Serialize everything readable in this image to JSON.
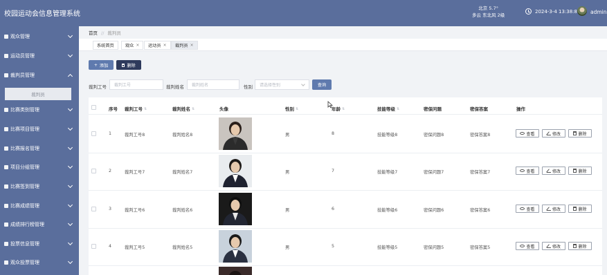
{
  "header": {
    "app_title": "校园运动会信息管理系统",
    "weather_city": "北京",
    "weather_temp": "5.7°",
    "weather_desc": "多云  东北风  2级",
    "datetime": "2024-3-4 13:38:8",
    "username": "admin"
  },
  "sidebar": {
    "items": [
      {
        "label": "观众管理",
        "expanded": false
      },
      {
        "label": "运动员管理",
        "expanded": false
      },
      {
        "label": "裁判员管理",
        "expanded": true
      },
      {
        "label": "比赛类别管理",
        "expanded": false
      },
      {
        "label": "比赛项目管理",
        "expanded": false
      },
      {
        "label": "比赛报名管理",
        "expanded": false
      },
      {
        "label": "项目分组管理",
        "expanded": false
      },
      {
        "label": "比赛签到管理",
        "expanded": false
      },
      {
        "label": "比赛成绩管理",
        "expanded": false
      },
      {
        "label": "成绩排行榜管理",
        "expanded": false
      },
      {
        "label": "投票信息管理",
        "expanded": false
      },
      {
        "label": "观众投票管理",
        "expanded": false
      }
    ],
    "active_sub": "裁判员"
  },
  "breadcrumb": {
    "home": "首页",
    "separator": "//",
    "current": "裁判员"
  },
  "tabs": [
    {
      "label": "系统首页",
      "closable": false
    },
    {
      "label": "观众",
      "closable": true
    },
    {
      "label": "运动员",
      "closable": true
    },
    {
      "label": "裁判员",
      "closable": true,
      "active": true
    }
  ],
  "tab_close_glyph": "×",
  "actions": {
    "add_label": "添加",
    "add_icon": "+",
    "delete_label": "删除"
  },
  "search": {
    "id_label": "裁判工号",
    "id_placeholder": "裁判工号",
    "name_label": "裁判姓名",
    "name_placeholder": "裁判姓名",
    "gender_label": "性别",
    "gender_placeholder": "请选择性别",
    "query_label": "查询"
  },
  "table": {
    "columns": [
      "序号",
      "裁判工号",
      "裁判姓名",
      "头像",
      "性别",
      "年龄",
      "技能等级",
      "密保问题",
      "密保答案",
      "操作"
    ],
    "rows": [
      {
        "index": "1",
        "judge_id": "裁判工号8",
        "judge_name": "裁判姓名8",
        "gender": "男",
        "age": "8",
        "skill": "技能等级8",
        "question": "密保问题8",
        "answer": "密保答案8"
      },
      {
        "index": "2",
        "judge_id": "裁判工号7",
        "judge_name": "裁判姓名7",
        "gender": "男",
        "age": "7",
        "skill": "技能等级7",
        "question": "密保问题7",
        "answer": "密保答案7"
      },
      {
        "index": "3",
        "judge_id": "裁判工号6",
        "judge_name": "裁判姓名6",
        "gender": "男",
        "age": "6",
        "skill": "技能等级6",
        "question": "密保问题6",
        "answer": "密保答案6"
      },
      {
        "index": "4",
        "judge_id": "裁判工号5",
        "judge_name": "裁判姓名5",
        "gender": "男",
        "age": "5",
        "skill": "技能等级5",
        "question": "密保问题5",
        "answer": "密保答案5"
      }
    ],
    "row_actions": {
      "view": "查看",
      "edit": "修改",
      "delete": "删除"
    }
  },
  "colors": {
    "sidebar_bg": "#5a6e9c",
    "primary": "#5f7aae",
    "danger_dark": "#2e3a5c"
  }
}
